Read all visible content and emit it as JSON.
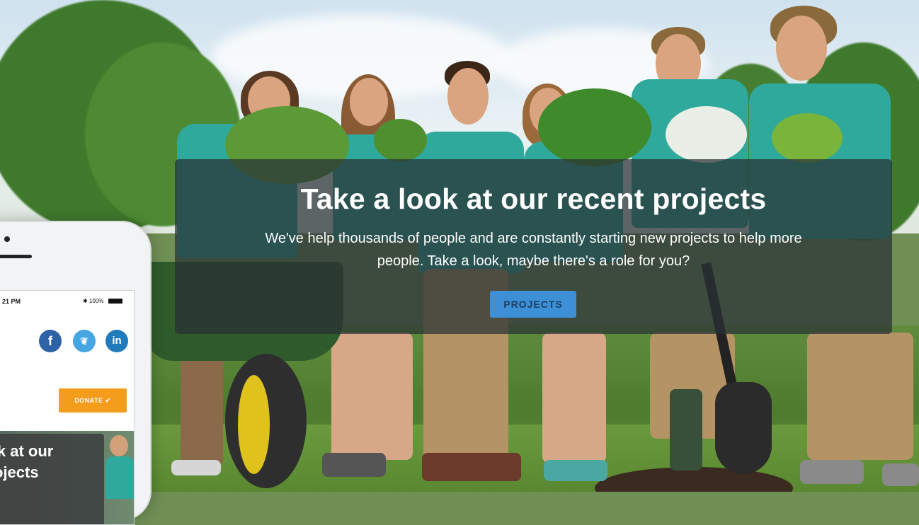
{
  "hero": {
    "title": "Take a look at our recent projects",
    "subtitle_line1": "We've help thousands of people and are constantly starting new projects to help more",
    "subtitle_line2": "people. Take a look, maybe there's a role for you?",
    "cta_label": "PROJECTS"
  },
  "phone": {
    "status_time": "21 PM",
    "status_battery": "✱ 100%",
    "social": {
      "facebook": "f",
      "twitter": "❦",
      "linkedin": "in"
    },
    "donate_label": "DONATE ✔",
    "hero_title_line1": "ook at our",
    "hero_title_line2": "projects"
  },
  "colors": {
    "overlay": "#283034",
    "cta_button": "#3d8fd6",
    "donate_button": "#f49c1c",
    "facebook": "#2d62a6",
    "twitter": "#46a6e3",
    "linkedin": "#1f7bbb",
    "shirt": "#2fa99b"
  }
}
